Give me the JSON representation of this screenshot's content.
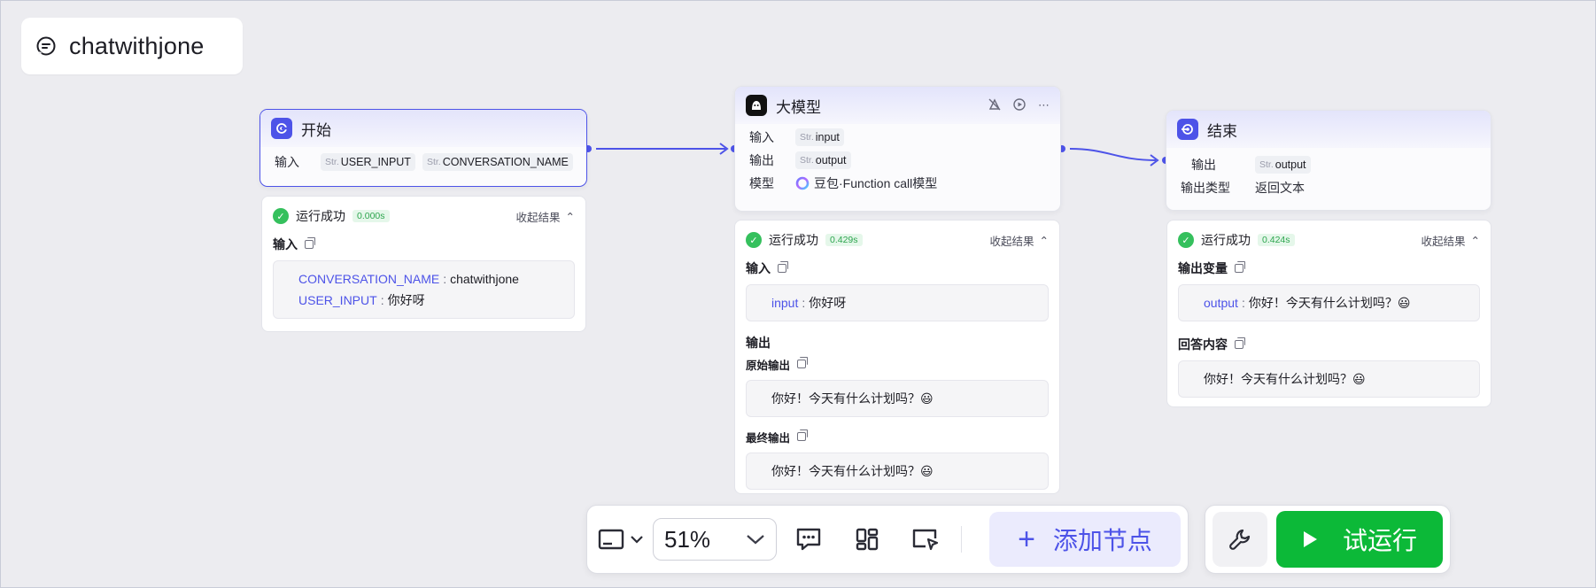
{
  "workflow": {
    "title": "chatwithjone"
  },
  "colors": {
    "accent": "#4d53e8",
    "success": "#35c05d",
    "run": "#0cb938"
  },
  "start_node": {
    "title": "开始",
    "icon": "start-icon",
    "input_label": "输入",
    "inputs": [
      {
        "type": "Str.",
        "name": "USER_INPUT"
      },
      {
        "type": "Str.",
        "name": "CONVERSATION_NAME"
      }
    ],
    "result": {
      "status": "运行成功",
      "time": "0.000s",
      "collapse": "收起结果",
      "input_label": "输入",
      "values": [
        {
          "key": "CONVERSATION_NAME",
          "value": "chatwithjone"
        },
        {
          "key": "USER_INPUT",
          "value": "你好呀"
        }
      ]
    }
  },
  "llm_node": {
    "title": "大模型",
    "icon": "llm-icon",
    "input_label": "输入",
    "input": {
      "type": "Str.",
      "name": "input"
    },
    "output_label": "输出",
    "output": {
      "type": "Str.",
      "name": "output"
    },
    "model_label": "模型",
    "model": "豆包·Function call模型",
    "result": {
      "status": "运行成功",
      "time": "0.429s",
      "collapse": "收起结果",
      "input_label": "输入",
      "input_key": "input",
      "input_value": "你好呀",
      "output_label": "输出",
      "raw_output_label": "原始输出",
      "raw_output": "你好！今天有什么计划吗？😃",
      "final_output_label": "最终输出",
      "final_output": "你好！今天有什么计划吗？😃"
    }
  },
  "end_node": {
    "title": "结束",
    "icon": "end-icon",
    "output_label": "输出",
    "output": {
      "type": "Str.",
      "name": "output"
    },
    "output_type_label": "输出类型",
    "output_type": "返回文本",
    "result": {
      "status": "运行成功",
      "time": "0.424s",
      "collapse": "收起结果",
      "var_label": "输出变量",
      "var_key": "output",
      "var_value": "你好！今天有什么计划吗？😃",
      "answer_label": "回答内容",
      "answer": "你好！今天有什么计划吗？😃"
    }
  },
  "toolbar": {
    "zoom": "51%",
    "add_node": "添加节点",
    "run": "试运行"
  }
}
